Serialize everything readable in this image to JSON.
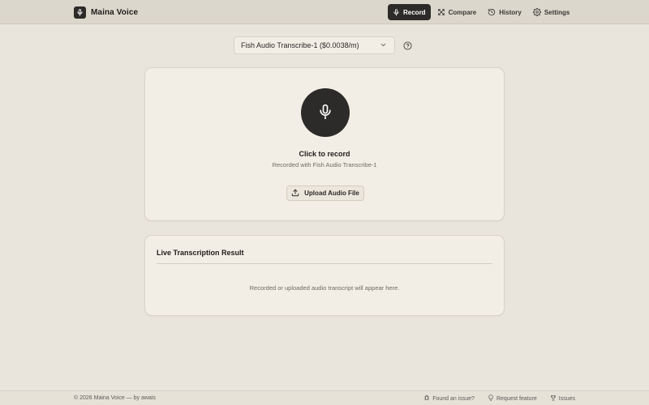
{
  "app": {
    "name": "Maina Voice",
    "logo_icon": "mic-icon"
  },
  "nav": {
    "items": [
      {
        "label": "Record",
        "icon": "mic-icon",
        "active": true
      },
      {
        "label": "Compare",
        "icon": "compare-icon",
        "active": false
      },
      {
        "label": "History",
        "icon": "history-icon",
        "active": false
      },
      {
        "label": "Settings",
        "icon": "gear-icon",
        "active": false
      }
    ]
  },
  "model_select": {
    "value": "Fish Audio Transcribe-1 ($0.0038/m)",
    "help_icon": "help-circle-icon"
  },
  "recorder": {
    "title": "Click to record",
    "subtitle": "Recorded with Fish Audio Transcribe-1",
    "upload_label": "Upload Audio File",
    "upload_icon": "upload-icon"
  },
  "result": {
    "title": "Live Transcription Result",
    "placeholder": "Recorded or uploaded audio transcript will appear here."
  },
  "footer": {
    "copyright": "© 2026 Maina Voice — by awais",
    "links": [
      {
        "label": "Found an issue?",
        "icon": "bug-icon"
      },
      {
        "label": "Request feature",
        "icon": "lightbulb-icon"
      },
      {
        "label": "Issues",
        "icon": "trophy-icon"
      }
    ]
  },
  "colors": {
    "background": "#e9e5dc",
    "header": "#dcd7cc",
    "card": "#f2eee5",
    "accent_dark": "#2d2b29"
  }
}
